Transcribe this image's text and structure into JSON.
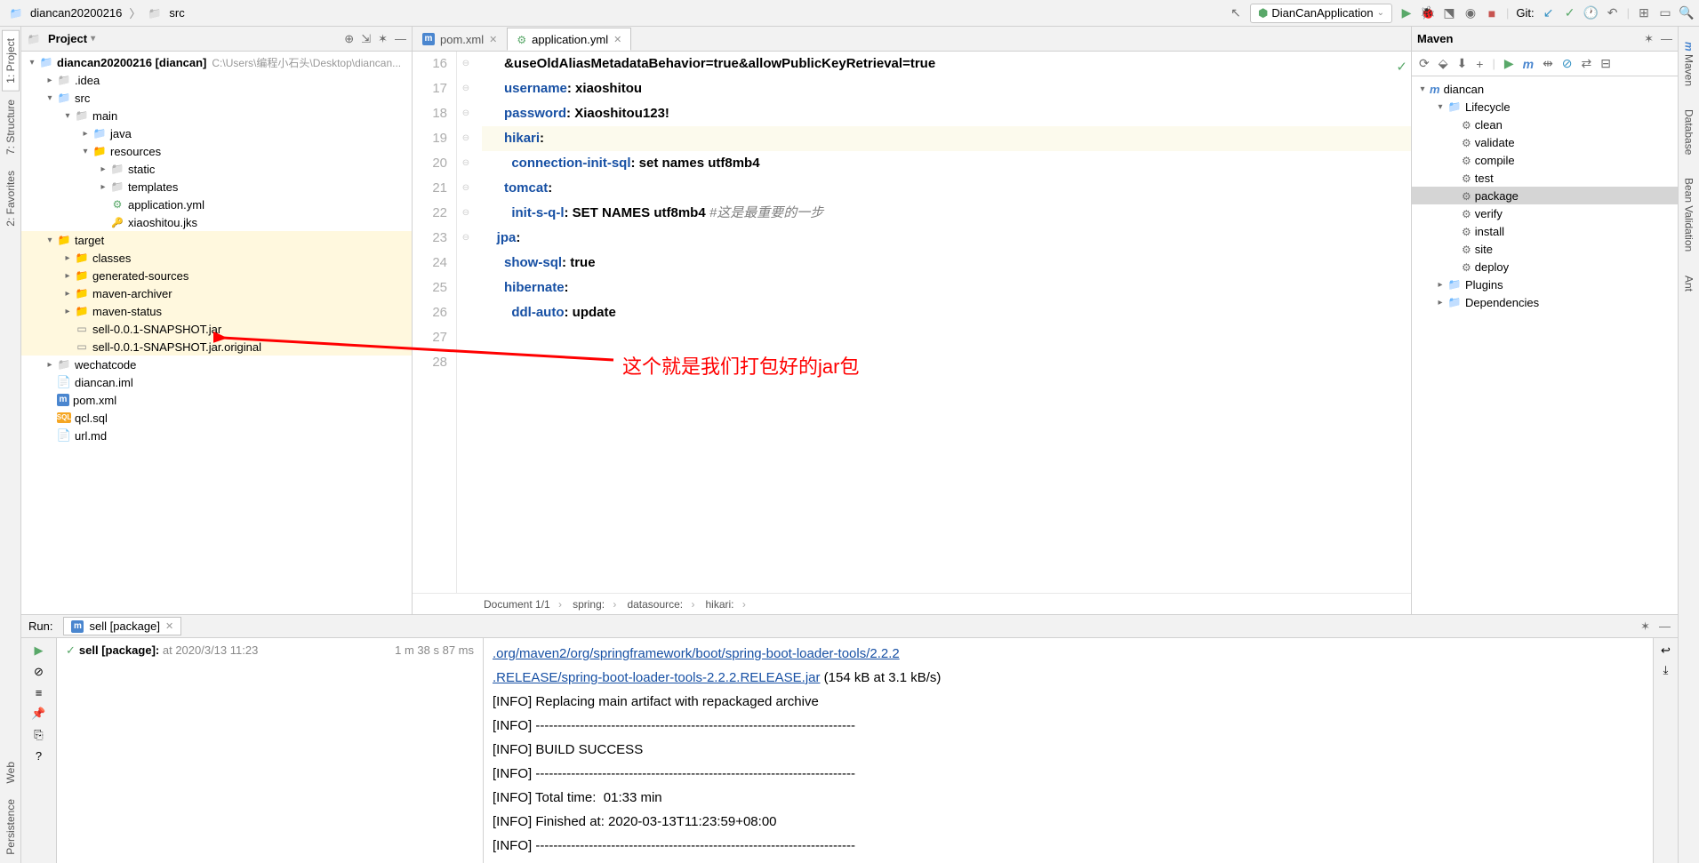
{
  "breadcrumb": {
    "root": "diancan20200216",
    "src": "src"
  },
  "runConfig": "DianCanApplication",
  "gitLabel": "Git:",
  "projectPanel": {
    "title": "Project",
    "rootName": "diancan20200216",
    "rootModule": "[diancan]",
    "rootPath": "C:\\Users\\编程小石头\\Desktop\\diancan...",
    "idea": ".idea",
    "src": "src",
    "main": "main",
    "java": "java",
    "resources": "resources",
    "static": "static",
    "templates": "templates",
    "appYml": "application.yml",
    "jks": "xiaoshitou.jks",
    "target": "target",
    "classes": "classes",
    "genSources": "generated-sources",
    "mavenArchiver": "maven-archiver",
    "mavenStatus": "maven-status",
    "jar": "sell-0.0.1-SNAPSHOT.jar",
    "jarOrig": "sell-0.0.1-SNAPSHOT.jar.original",
    "wechatcode": "wechatcode",
    "diancanIml": "diancan.iml",
    "pom": "pom.xml",
    "qcl": "qcl.sql",
    "url": "url.md"
  },
  "tabs": {
    "pom": "pom.xml",
    "app": "application.yml"
  },
  "editor": {
    "startLine": 16,
    "lines": [
      {
        "indent": 3,
        "raw": "&useOldAliasMetadataBehavior=true&allowPublicKeyRetrieval=true",
        "type": "cont"
      },
      {
        "indent": 3,
        "key": "username",
        "val": "xiaoshitou"
      },
      {
        "indent": 3,
        "key": "password",
        "val": "Xiaoshitou123!"
      },
      {
        "indent": 3,
        "key": "hikari",
        "val": "",
        "hl": true
      },
      {
        "indent": 4,
        "key": "connection-init-sql",
        "val": "set names utf8mb4"
      },
      {
        "indent": 3,
        "key": "tomcat",
        "val": ""
      },
      {
        "indent": 4,
        "key": "init-s-q-l",
        "val": "SET NAMES utf8mb4",
        "comment": "#这是最重要的一步"
      },
      {
        "indent": 2,
        "key": "jpa",
        "val": ""
      },
      {
        "indent": 3,
        "key": "show-sql",
        "val": "true"
      },
      {
        "indent": 3,
        "key": "hibernate",
        "val": ""
      },
      {
        "indent": 4,
        "key": "ddl-auto",
        "val": "update"
      },
      {
        "indent": 0,
        "raw": ""
      },
      {
        "indent": 0,
        "raw": ""
      }
    ]
  },
  "statusCrumb": {
    "doc": "Document 1/1",
    "c1": "spring:",
    "c2": "datasource:",
    "c3": "hikari:"
  },
  "maven": {
    "title": "Maven",
    "root": "diancan",
    "lifecycle": "Lifecycle",
    "goals": [
      "clean",
      "validate",
      "compile",
      "test",
      "package",
      "verify",
      "install",
      "site",
      "deploy"
    ],
    "selectedGoal": "package",
    "plugins": "Plugins",
    "deps": "Dependencies"
  },
  "run": {
    "label": "Run:",
    "tabName": "sell [package]",
    "taskName": "sell [package]:",
    "taskTime": "at 2020/3/13 11:23",
    "duration": "1 m 38 s 87 ms",
    "link1": ".org/maven2/org/springframework/boot/spring-boot-loader-tools/2.2.2",
    "link2": ".RELEASE/spring-boot-loader-tools-2.2.2.RELEASE.jar",
    "linkSuffix": " (154 kB at 3.1 kB/s)",
    "out": [
      "[INFO] Replacing main artifact with repackaged archive",
      "[INFO] ------------------------------------------------------------------------",
      "[INFO] BUILD SUCCESS",
      "[INFO] ------------------------------------------------------------------------",
      "[INFO] Total time:  01:33 min",
      "[INFO] Finished at: 2020-03-13T11:23:59+08:00",
      "[INFO] ------------------------------------------------------------------------"
    ]
  },
  "leftTabs": {
    "project": "1: Project",
    "structure": "7: Structure",
    "favorites": "2: Favorites",
    "web": "Web",
    "persistence": "Persistence"
  },
  "rightTabs": {
    "maven": "Maven",
    "database": "Database",
    "bean": "Bean Validation",
    "ant": "Ant"
  },
  "annotation": "这个就是我们打包好的jar包"
}
